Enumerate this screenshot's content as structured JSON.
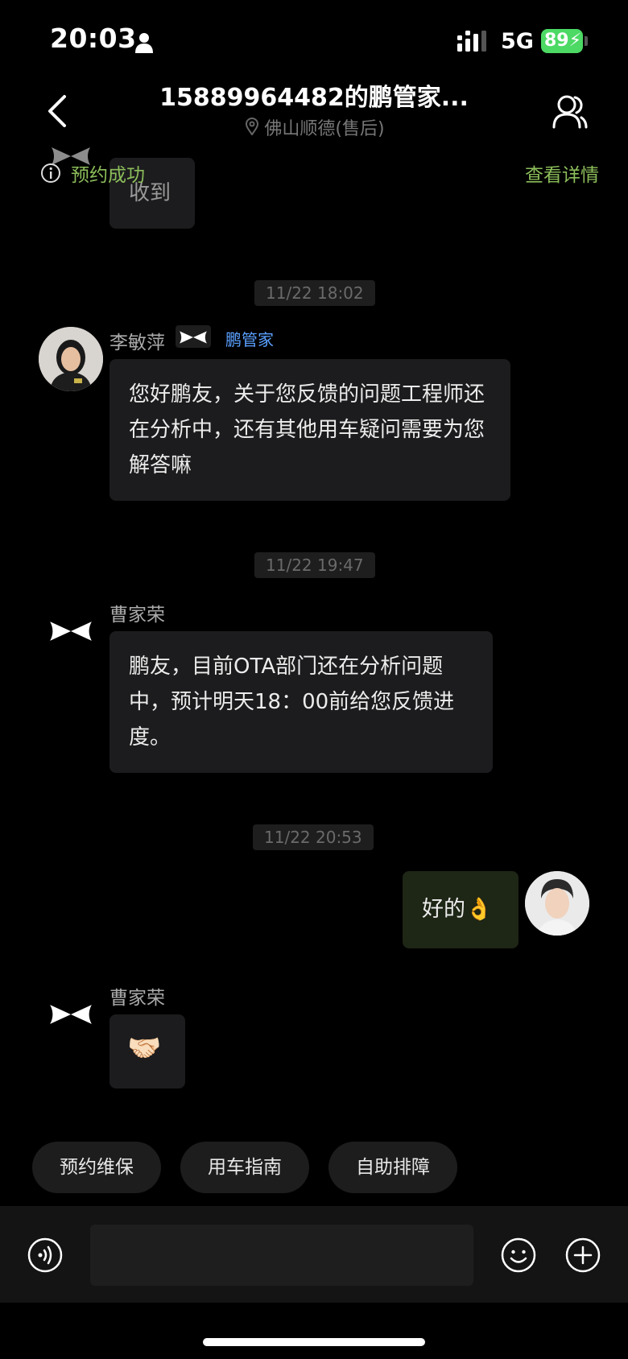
{
  "status_bar": {
    "time": "20:03",
    "network": "5G",
    "battery": "89"
  },
  "header": {
    "title": "15889964482的鹏管家...",
    "subtitle": "佛山顺德(售后)"
  },
  "banner": {
    "label": "预约成功",
    "link": "查看详情"
  },
  "messages": [
    {
      "text": "收到"
    },
    {
      "timestamp": "11/22 18:02",
      "sender": "李敏萍",
      "badge": "鹏管家",
      "text": "您好鹏友，关于您反馈的问题工程师还在分析中，还有其他用车疑问需要为您解答嘛"
    },
    {
      "timestamp": "11/22 19:47",
      "sender": "曹家荣",
      "text": "鹏友，目前OTA部门还在分析问题中，预计明天18：00前给您反馈进度。"
    },
    {
      "timestamp": "11/22 20:53",
      "text": "好的👌"
    },
    {
      "sender": "曹家荣",
      "text": "🤝🏻"
    }
  ],
  "shortcuts": [
    "预约维保",
    "用车指南",
    "自助排障"
  ],
  "input": {
    "value": "",
    "placeholder": ""
  },
  "colors": {
    "accent_green": "#8cbd5a",
    "badge_blue": "#5aa0ff",
    "outgoing_bubble": "#1e2616",
    "battery": "#4cd964"
  },
  "icons": [
    "person-icon",
    "signal-icon",
    "back-icon",
    "location-icon",
    "contact-icon",
    "info-icon",
    "brand-logo-icon",
    "voice-icon",
    "emoji-icon",
    "plus-icon"
  ]
}
